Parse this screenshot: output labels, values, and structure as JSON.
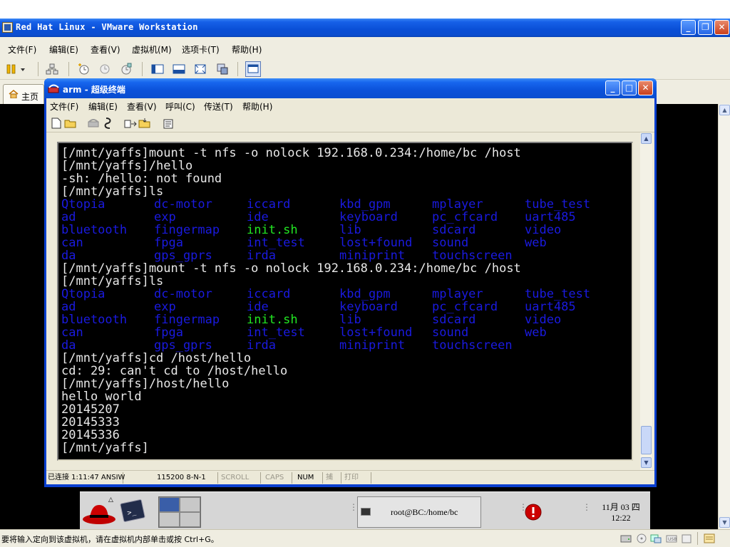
{
  "vmware": {
    "title": "Red Hat Linux - VMware Workstation",
    "menu": [
      "文件(F)",
      "编辑(E)",
      "查看(V)",
      "虚拟机(M)",
      "选项卡(T)",
      "帮助(H)"
    ],
    "home_tab": "主页",
    "status_message": "要将输入定向到该虚拟机，请在虚拟机内部单击或按 Ctrl+G。"
  },
  "terminal": {
    "title": "arm - 超级终端",
    "menu": [
      "文件(F)",
      "编辑(E)",
      "查看(V)",
      "呼叫(C)",
      "传送(T)",
      "帮助(H)"
    ],
    "lines": [
      {
        "text": "[/mnt/yaffs]mount -t nfs -o nolock 192.168.0.234:/home/bc /host"
      },
      {
        "text": "[/mnt/yaffs]/hello"
      },
      {
        "text": "-sh: /hello: not found"
      },
      {
        "text": "[/mnt/yaffs]ls"
      },
      {
        "cells": [
          [
            "Qtopia",
            "b"
          ],
          [
            "dc-motor",
            "b"
          ],
          [
            "iccard",
            "b"
          ],
          [
            "kbd_gpm",
            "b"
          ],
          [
            "mplayer",
            "b"
          ],
          [
            "tube_test",
            "b"
          ]
        ]
      },
      {
        "cells": [
          [
            "ad",
            "b"
          ],
          [
            "exp",
            "b"
          ],
          [
            "ide",
            "b"
          ],
          [
            "keyboard",
            "b"
          ],
          [
            "pc_cfcard",
            "b"
          ],
          [
            "uart485",
            "b"
          ]
        ]
      },
      {
        "cells": [
          [
            "bluetooth",
            "b"
          ],
          [
            "fingermap",
            "b"
          ],
          [
            "init.sh",
            "g"
          ],
          [
            "lib",
            "b"
          ],
          [
            "sdcard",
            "b"
          ],
          [
            "video",
            "b"
          ]
        ]
      },
      {
        "cells": [
          [
            "can",
            "b"
          ],
          [
            "fpga",
            "b"
          ],
          [
            "int_test",
            "b"
          ],
          [
            "lost+found",
            "b"
          ],
          [
            "sound",
            "b"
          ],
          [
            "web",
            "b"
          ]
        ]
      },
      {
        "cells": [
          [
            "da",
            "b"
          ],
          [
            "gps_gprs",
            "b"
          ],
          [
            "irda",
            "b"
          ],
          [
            "miniprint",
            "b"
          ],
          [
            "touchscreen",
            "b"
          ]
        ]
      },
      {
        "text": "[/mnt/yaffs]mount -t nfs -o nolock 192.168.0.234:/home/bc /host"
      },
      {
        "text": "[/mnt/yaffs]ls"
      },
      {
        "cells": [
          [
            "Qtopia",
            "b"
          ],
          [
            "dc-motor",
            "b"
          ],
          [
            "iccard",
            "b"
          ],
          [
            "kbd_gpm",
            "b"
          ],
          [
            "mplayer",
            "b"
          ],
          [
            "tube_test",
            "b"
          ]
        ]
      },
      {
        "cells": [
          [
            "ad",
            "b"
          ],
          [
            "exp",
            "b"
          ],
          [
            "ide",
            "b"
          ],
          [
            "keyboard",
            "b"
          ],
          [
            "pc_cfcard",
            "b"
          ],
          [
            "uart485",
            "b"
          ]
        ]
      },
      {
        "cells": [
          [
            "bluetooth",
            "b"
          ],
          [
            "fingermap",
            "b"
          ],
          [
            "init.sh",
            "g"
          ],
          [
            "lib",
            "b"
          ],
          [
            "sdcard",
            "b"
          ],
          [
            "video",
            "b"
          ]
        ]
      },
      {
        "cells": [
          [
            "can",
            "b"
          ],
          [
            "fpga",
            "b"
          ],
          [
            "int_test",
            "b"
          ],
          [
            "lost+found",
            "b"
          ],
          [
            "sound",
            "b"
          ],
          [
            "web",
            "b"
          ]
        ]
      },
      {
        "cells": [
          [
            "da",
            "b"
          ],
          [
            "gps_gprs",
            "b"
          ],
          [
            "irda",
            "b"
          ],
          [
            "miniprint",
            "b"
          ],
          [
            "touchscreen",
            "b"
          ]
        ]
      },
      {
        "text": "[/mnt/yaffs]cd /host/hello"
      },
      {
        "text": "cd: 29: can't cd to /host/hello"
      },
      {
        "text": "[/mnt/yaffs]/host/hello"
      },
      {
        "text": "hello world"
      },
      {
        "text": "20145207"
      },
      {
        "text": "20145333"
      },
      {
        "text": "20145336"
      },
      {
        "text": "[/mnt/yaffs]"
      }
    ],
    "status": {
      "connected": "已连接 1:11:47",
      "emulation": "ANSIW",
      "port": "115200 8-N-1",
      "scroll": "SCROLL",
      "caps": "CAPS",
      "num": "NUM",
      "capture": "捕",
      "print": "打印"
    }
  },
  "guest_panel": {
    "task_label": "root@BC:/home/bc",
    "date": "11月 03 四",
    "time": "12:22"
  },
  "colors": {
    "xp_blue": "#0a4fd6",
    "term_blue_text": "#1a1ae0",
    "term_green_text": "#22e622",
    "chrome": "#ece9d8"
  }
}
